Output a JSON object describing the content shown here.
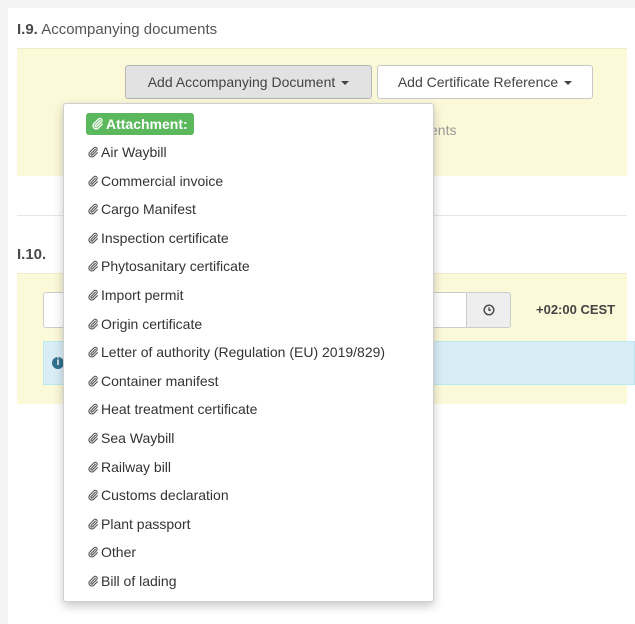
{
  "section_19": {
    "number": "I.9.",
    "title": "Accompanying documents",
    "add_document_label": "Add Accompanying Document",
    "add_certificate_label": "Add Certificate Reference",
    "partial_text": "ents"
  },
  "section_110": {
    "number": "I.10.",
    "timezone": "+02:00 CEST"
  },
  "dropdown": {
    "header": "Attachment:",
    "items": [
      "Air Waybill",
      "Commercial invoice",
      "Cargo Manifest",
      "Inspection certificate",
      "Phytosanitary certificate",
      "Import permit",
      "Origin certificate",
      "Letter of authority (Regulation (EU) 2019/829)",
      "Container manifest",
      "Heat treatment certificate",
      "Sea Waybill",
      "Railway bill",
      "Customs declaration",
      "Plant passport",
      "Other",
      "Bill of lading"
    ]
  },
  "icons": {
    "item": "paperclip-icon",
    "clock": "clock-icon",
    "info": "info-icon",
    "caret": "caret-down-icon"
  },
  "colors": {
    "attachment_badge": "#5cb85c",
    "section_box": "#fbf9d8",
    "info_bar": "#d9edf7"
  }
}
